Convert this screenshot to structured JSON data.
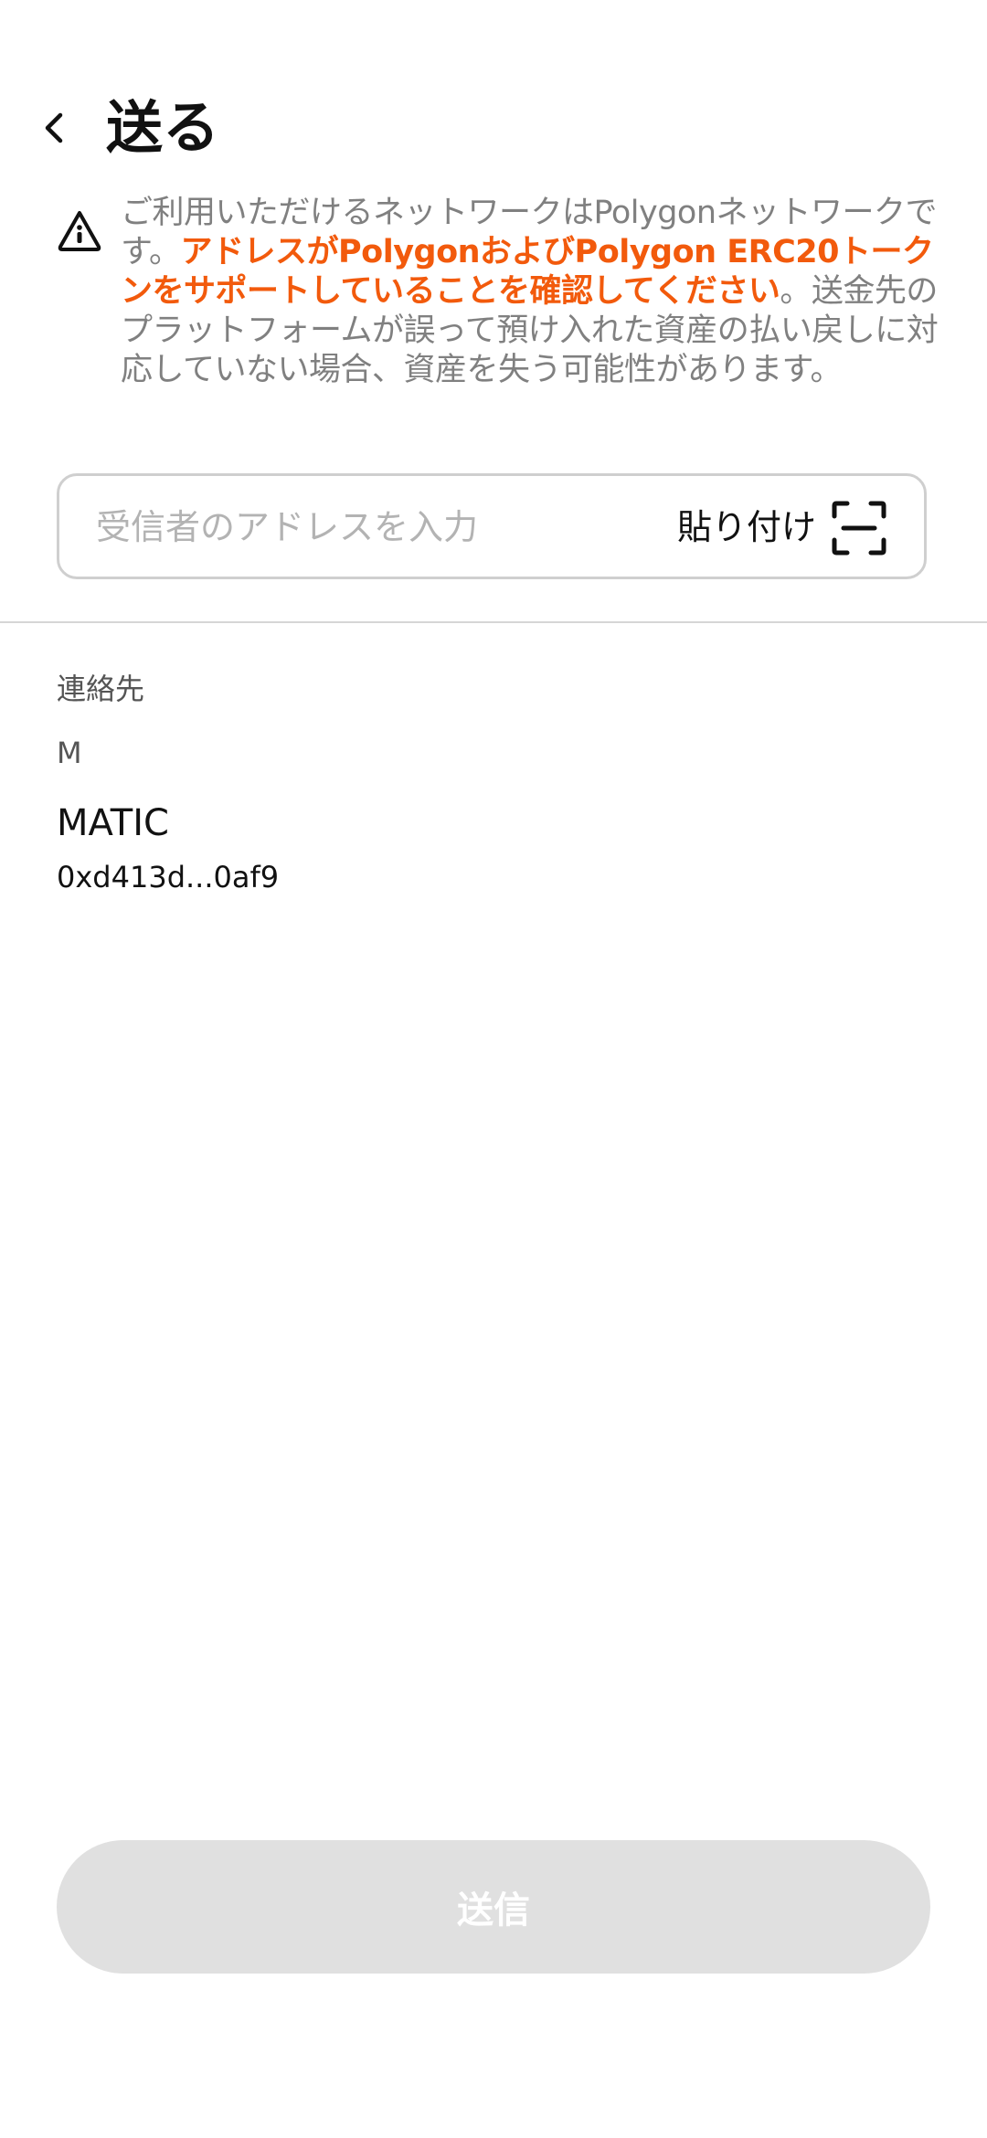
{
  "header": {
    "title": "送る",
    "back_icon": "chevron-left-icon"
  },
  "notice": {
    "icon": "warning-triangle-icon",
    "text_prefix": "ご利用いただけるネットワークはPolygonネットワークです。",
    "text_warning": "アドレスがPolygonおよびPolygon ERC20トークンをサポートしていることを確認してください",
    "text_suffix": "。送金先のプラットフォームが誤って預け入れた資産の払い戻しに対応していない場合、資産を失う可能性があります。",
    "warning_color": "#f25a0c"
  },
  "address_input": {
    "placeholder": "受信者のアドレスを入力",
    "value": "",
    "paste_label": "貼り付け",
    "scan_icon": "scan-icon"
  },
  "contacts": {
    "section_title": "連絡先",
    "groups": [
      {
        "letter": "M",
        "items": [
          {
            "name": "MATIC",
            "address": "0xd413d...0af9"
          }
        ]
      }
    ]
  },
  "footer": {
    "send_label": "送信",
    "send_enabled": false
  }
}
